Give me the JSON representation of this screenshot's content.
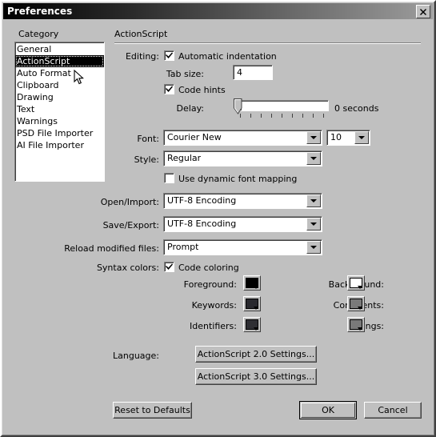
{
  "window": {
    "title": "Preferences",
    "close_icon": "close-icon"
  },
  "sidebar": {
    "label": "Category",
    "items": [
      {
        "label": "General",
        "selected": false
      },
      {
        "label": "ActionScript",
        "selected": true
      },
      {
        "label": "Auto Format",
        "selected": false
      },
      {
        "label": "Clipboard",
        "selected": false
      },
      {
        "label": "Drawing",
        "selected": false
      },
      {
        "label": "Text",
        "selected": false
      },
      {
        "label": "Warnings",
        "selected": false
      },
      {
        "label": "PSD File Importer",
        "selected": false
      },
      {
        "label": "AI File Importer",
        "selected": false
      }
    ]
  },
  "panel": {
    "title": "ActionScript",
    "editing": {
      "label": "Editing:",
      "automatic_indentation": {
        "label": "Automatic indentation",
        "checked": true
      },
      "tab_size": {
        "label": "Tab size:",
        "value": "4"
      },
      "code_hints": {
        "label": "Code hints",
        "checked": true
      },
      "delay": {
        "label": "Delay:",
        "value": "0 seconds",
        "position_percent": 0
      }
    },
    "font": {
      "label": "Font:",
      "family_value": "Courier New",
      "size_value": "10"
    },
    "style": {
      "label": "Style:",
      "value": "Regular"
    },
    "dynamic_font_mapping": {
      "label": "Use dynamic font mapping",
      "checked": false
    },
    "open_import": {
      "label": "Open/Import:",
      "value": "UTF-8 Encoding"
    },
    "save_export": {
      "label": "Save/Export:",
      "value": "UTF-8 Encoding"
    },
    "reload_modified": {
      "label": "Reload modified files:",
      "value": "Prompt"
    },
    "syntax_colors": {
      "label": "Syntax colors:",
      "code_coloring": {
        "label": "Code coloring",
        "checked": true
      },
      "swatches": [
        {
          "label": "Foreground:",
          "color": "#000000"
        },
        {
          "label": "Background:",
          "color": "#ffffff"
        },
        {
          "label": "Keywords:",
          "color": "#28282e"
        },
        {
          "label": "Comments:",
          "color": "#7a7a7a"
        },
        {
          "label": "Identifiers:",
          "color": "#2e2e33"
        },
        {
          "label": "Strings:",
          "color": "#7a7a7a"
        }
      ]
    },
    "language": {
      "label": "Language:",
      "as2_button": "ActionScript 2.0 Settings...",
      "as3_button": "ActionScript 3.0 Settings..."
    }
  },
  "footer": {
    "reset": "Reset to Defaults",
    "ok": "OK",
    "cancel": "Cancel"
  }
}
